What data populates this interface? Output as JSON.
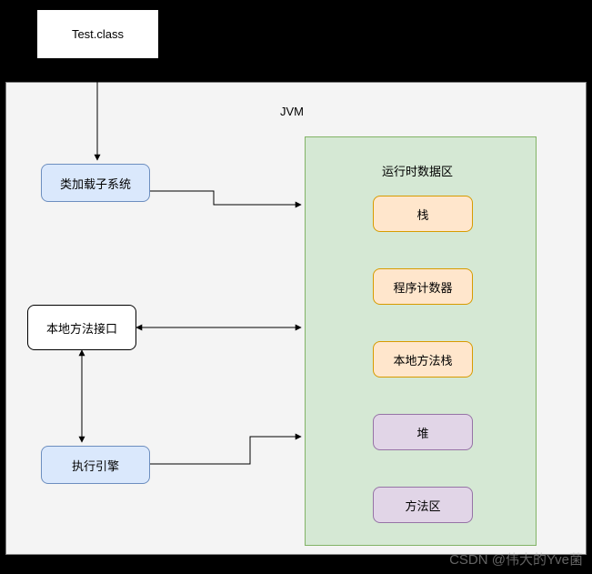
{
  "nodes": {
    "test_class": "Test.class",
    "jvm_label": "JVM",
    "class_loader": "类加载子系统",
    "native_interface": "本地方法接口",
    "execution_engine": "执行引擎",
    "runtime_area_label": "运行时数据区",
    "stack": "栈",
    "pc_register": "程序计数器",
    "native_stack": "本地方法栈",
    "heap": "堆",
    "method_area": "方法区"
  },
  "watermark": "CSDN @伟大的Yve菌",
  "chart_data": {
    "type": "diagram",
    "title": "JVM",
    "nodes": [
      {
        "id": "test_class",
        "label": "Test.class",
        "style": "white-box"
      },
      {
        "id": "jvm",
        "label": "JVM",
        "style": "container"
      },
      {
        "id": "class_loader",
        "label": "类加载子系统",
        "style": "blue",
        "parent": "jvm"
      },
      {
        "id": "native_interface",
        "label": "本地方法接口",
        "style": "white",
        "parent": "jvm"
      },
      {
        "id": "execution_engine",
        "label": "执行引擎",
        "style": "blue",
        "parent": "jvm"
      },
      {
        "id": "runtime_area",
        "label": "运行时数据区",
        "style": "green-container",
        "parent": "jvm"
      },
      {
        "id": "stack",
        "label": "栈",
        "style": "orange",
        "parent": "runtime_area"
      },
      {
        "id": "pc_register",
        "label": "程序计数器",
        "style": "orange",
        "parent": "runtime_area"
      },
      {
        "id": "native_stack",
        "label": "本地方法栈",
        "style": "orange",
        "parent": "runtime_area"
      },
      {
        "id": "heap",
        "label": "堆",
        "style": "purple",
        "parent": "runtime_area"
      },
      {
        "id": "method_area",
        "label": "方法区",
        "style": "purple",
        "parent": "runtime_area"
      }
    ],
    "edges": [
      {
        "from": "test_class",
        "to": "class_loader",
        "direction": "uni"
      },
      {
        "from": "class_loader",
        "to": "runtime_area",
        "direction": "uni"
      },
      {
        "from": "native_interface",
        "to": "runtime_area",
        "direction": "bi"
      },
      {
        "from": "native_interface",
        "to": "execution_engine",
        "direction": "bi"
      },
      {
        "from": "execution_engine",
        "to": "runtime_area",
        "direction": "uni"
      }
    ]
  }
}
